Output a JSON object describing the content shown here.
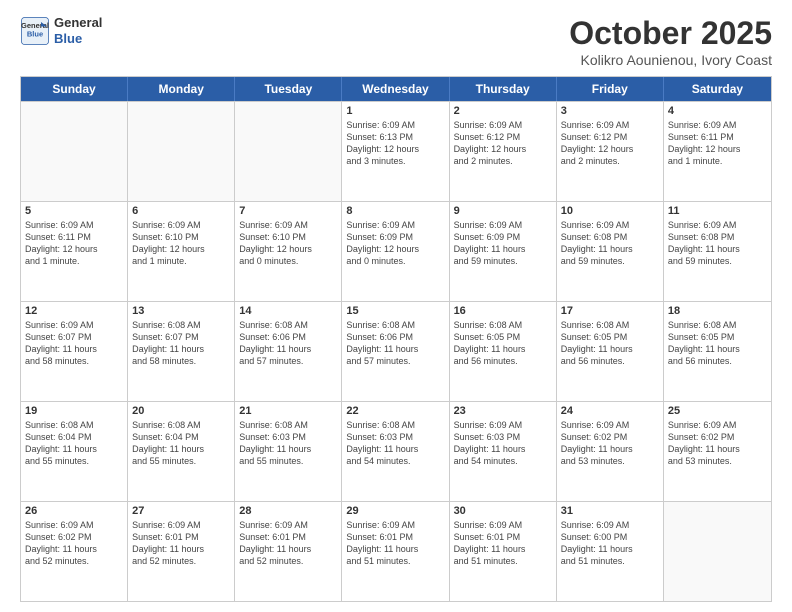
{
  "header": {
    "logo_line1": "General",
    "logo_line2": "Blue",
    "month": "October 2025",
    "location": "Kolikro Aounienou, Ivory Coast"
  },
  "weekdays": [
    "Sunday",
    "Monday",
    "Tuesday",
    "Wednesday",
    "Thursday",
    "Friday",
    "Saturday"
  ],
  "weeks": [
    [
      {
        "day": "",
        "text": ""
      },
      {
        "day": "",
        "text": ""
      },
      {
        "day": "",
        "text": ""
      },
      {
        "day": "1",
        "text": "Sunrise: 6:09 AM\nSunset: 6:13 PM\nDaylight: 12 hours\nand 3 minutes."
      },
      {
        "day": "2",
        "text": "Sunrise: 6:09 AM\nSunset: 6:12 PM\nDaylight: 12 hours\nand 2 minutes."
      },
      {
        "day": "3",
        "text": "Sunrise: 6:09 AM\nSunset: 6:12 PM\nDaylight: 12 hours\nand 2 minutes."
      },
      {
        "day": "4",
        "text": "Sunrise: 6:09 AM\nSunset: 6:11 PM\nDaylight: 12 hours\nand 1 minute."
      }
    ],
    [
      {
        "day": "5",
        "text": "Sunrise: 6:09 AM\nSunset: 6:11 PM\nDaylight: 12 hours\nand 1 minute."
      },
      {
        "day": "6",
        "text": "Sunrise: 6:09 AM\nSunset: 6:10 PM\nDaylight: 12 hours\nand 1 minute."
      },
      {
        "day": "7",
        "text": "Sunrise: 6:09 AM\nSunset: 6:10 PM\nDaylight: 12 hours\nand 0 minutes."
      },
      {
        "day": "8",
        "text": "Sunrise: 6:09 AM\nSunset: 6:09 PM\nDaylight: 12 hours\nand 0 minutes."
      },
      {
        "day": "9",
        "text": "Sunrise: 6:09 AM\nSunset: 6:09 PM\nDaylight: 11 hours\nand 59 minutes."
      },
      {
        "day": "10",
        "text": "Sunrise: 6:09 AM\nSunset: 6:08 PM\nDaylight: 11 hours\nand 59 minutes."
      },
      {
        "day": "11",
        "text": "Sunrise: 6:09 AM\nSunset: 6:08 PM\nDaylight: 11 hours\nand 59 minutes."
      }
    ],
    [
      {
        "day": "12",
        "text": "Sunrise: 6:09 AM\nSunset: 6:07 PM\nDaylight: 11 hours\nand 58 minutes."
      },
      {
        "day": "13",
        "text": "Sunrise: 6:08 AM\nSunset: 6:07 PM\nDaylight: 11 hours\nand 58 minutes."
      },
      {
        "day": "14",
        "text": "Sunrise: 6:08 AM\nSunset: 6:06 PM\nDaylight: 11 hours\nand 57 minutes."
      },
      {
        "day": "15",
        "text": "Sunrise: 6:08 AM\nSunset: 6:06 PM\nDaylight: 11 hours\nand 57 minutes."
      },
      {
        "day": "16",
        "text": "Sunrise: 6:08 AM\nSunset: 6:05 PM\nDaylight: 11 hours\nand 56 minutes."
      },
      {
        "day": "17",
        "text": "Sunrise: 6:08 AM\nSunset: 6:05 PM\nDaylight: 11 hours\nand 56 minutes."
      },
      {
        "day": "18",
        "text": "Sunrise: 6:08 AM\nSunset: 6:05 PM\nDaylight: 11 hours\nand 56 minutes."
      }
    ],
    [
      {
        "day": "19",
        "text": "Sunrise: 6:08 AM\nSunset: 6:04 PM\nDaylight: 11 hours\nand 55 minutes."
      },
      {
        "day": "20",
        "text": "Sunrise: 6:08 AM\nSunset: 6:04 PM\nDaylight: 11 hours\nand 55 minutes."
      },
      {
        "day": "21",
        "text": "Sunrise: 6:08 AM\nSunset: 6:03 PM\nDaylight: 11 hours\nand 55 minutes."
      },
      {
        "day": "22",
        "text": "Sunrise: 6:08 AM\nSunset: 6:03 PM\nDaylight: 11 hours\nand 54 minutes."
      },
      {
        "day": "23",
        "text": "Sunrise: 6:09 AM\nSunset: 6:03 PM\nDaylight: 11 hours\nand 54 minutes."
      },
      {
        "day": "24",
        "text": "Sunrise: 6:09 AM\nSunset: 6:02 PM\nDaylight: 11 hours\nand 53 minutes."
      },
      {
        "day": "25",
        "text": "Sunrise: 6:09 AM\nSunset: 6:02 PM\nDaylight: 11 hours\nand 53 minutes."
      }
    ],
    [
      {
        "day": "26",
        "text": "Sunrise: 6:09 AM\nSunset: 6:02 PM\nDaylight: 11 hours\nand 52 minutes."
      },
      {
        "day": "27",
        "text": "Sunrise: 6:09 AM\nSunset: 6:01 PM\nDaylight: 11 hours\nand 52 minutes."
      },
      {
        "day": "28",
        "text": "Sunrise: 6:09 AM\nSunset: 6:01 PM\nDaylight: 11 hours\nand 52 minutes."
      },
      {
        "day": "29",
        "text": "Sunrise: 6:09 AM\nSunset: 6:01 PM\nDaylight: 11 hours\nand 51 minutes."
      },
      {
        "day": "30",
        "text": "Sunrise: 6:09 AM\nSunset: 6:01 PM\nDaylight: 11 hours\nand 51 minutes."
      },
      {
        "day": "31",
        "text": "Sunrise: 6:09 AM\nSunset: 6:00 PM\nDaylight: 11 hours\nand 51 minutes."
      },
      {
        "day": "",
        "text": ""
      }
    ]
  ]
}
